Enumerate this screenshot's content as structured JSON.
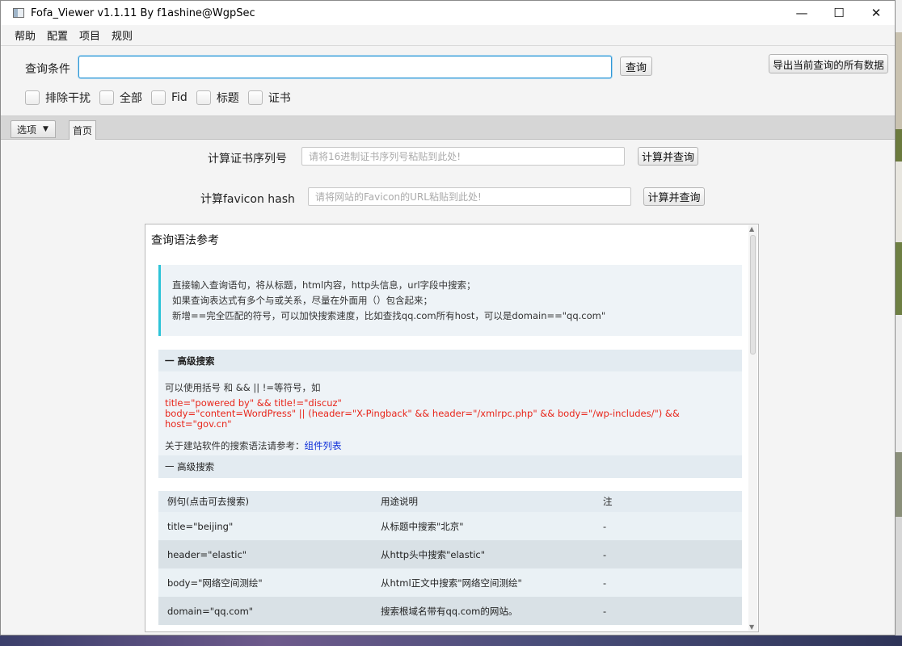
{
  "window": {
    "title": "Fofa_Viewer v1.1.11 By f1ashine@WgpSec",
    "controls": {
      "minimize": "—",
      "maximize": "☐",
      "close": "✕"
    }
  },
  "menu": [
    "帮助",
    "配置",
    "项目",
    "规则"
  ],
  "query": {
    "label": "查询条件",
    "value": "",
    "search_button": "查询",
    "export_button": "导出当前查询的所有数据"
  },
  "filters": [
    "排除干扰",
    "全部",
    "Fid",
    "标题",
    "证书"
  ],
  "tabs": {
    "options": "选项",
    "home": "首页"
  },
  "cert_calc": {
    "label": "计算证书序列号",
    "placeholder": "请将16进制证书序列号粘贴到此处!",
    "button": "计算并查询"
  },
  "favicon_calc": {
    "label": "计算favicon hash",
    "placeholder": "请将网站的Favicon的URL粘贴到此处!",
    "button": "计算并查询"
  },
  "reference": {
    "title": "查询语法参考",
    "tips": [
      "直接输入查询语句，将从标题，html内容，http头信息，url字段中搜索；",
      "如果查询表达式有多个与或关系，尽量在外面用（）包含起来；",
      "新增==完全匹配的符号，可以加快搜索速度，比如查找qq.com所有host，可以是domain==\"qq.com\""
    ],
    "advanced_header": "一  高级搜索",
    "advanced_intro": "可以使用括号 和 && || !=等符号，如",
    "example_1": "title=\"powered by\" && title!=\"discuz\"",
    "example_2": "body=\"content=WordPress\" || (header=\"X-Pingback\" && header=\"/xmlrpc.php\" && body=\"/wp-includes/\") && host=\"gov.cn\"",
    "component_prefix": "关于建站软件的搜索语法请参考：",
    "component_link": "组件列表",
    "advanced_header_2": "一  高级搜索",
    "table": {
      "headers": [
        "例句(点击可去搜索)",
        "用途说明",
        "注"
      ],
      "rows": [
        [
          "title=\"beijing\"",
          "从标题中搜索\"北京\"",
          "-"
        ],
        [
          "header=\"elastic\"",
          "从http头中搜索\"elastic\"",
          "-"
        ],
        [
          "body=\"网络空间测绘\"",
          "从html正文中搜索\"网络空间测绘\"",
          "-"
        ],
        [
          "domain=\"qq.com\"",
          "搜索根域名带有qq.com的网站。",
          "-"
        ]
      ]
    }
  }
}
